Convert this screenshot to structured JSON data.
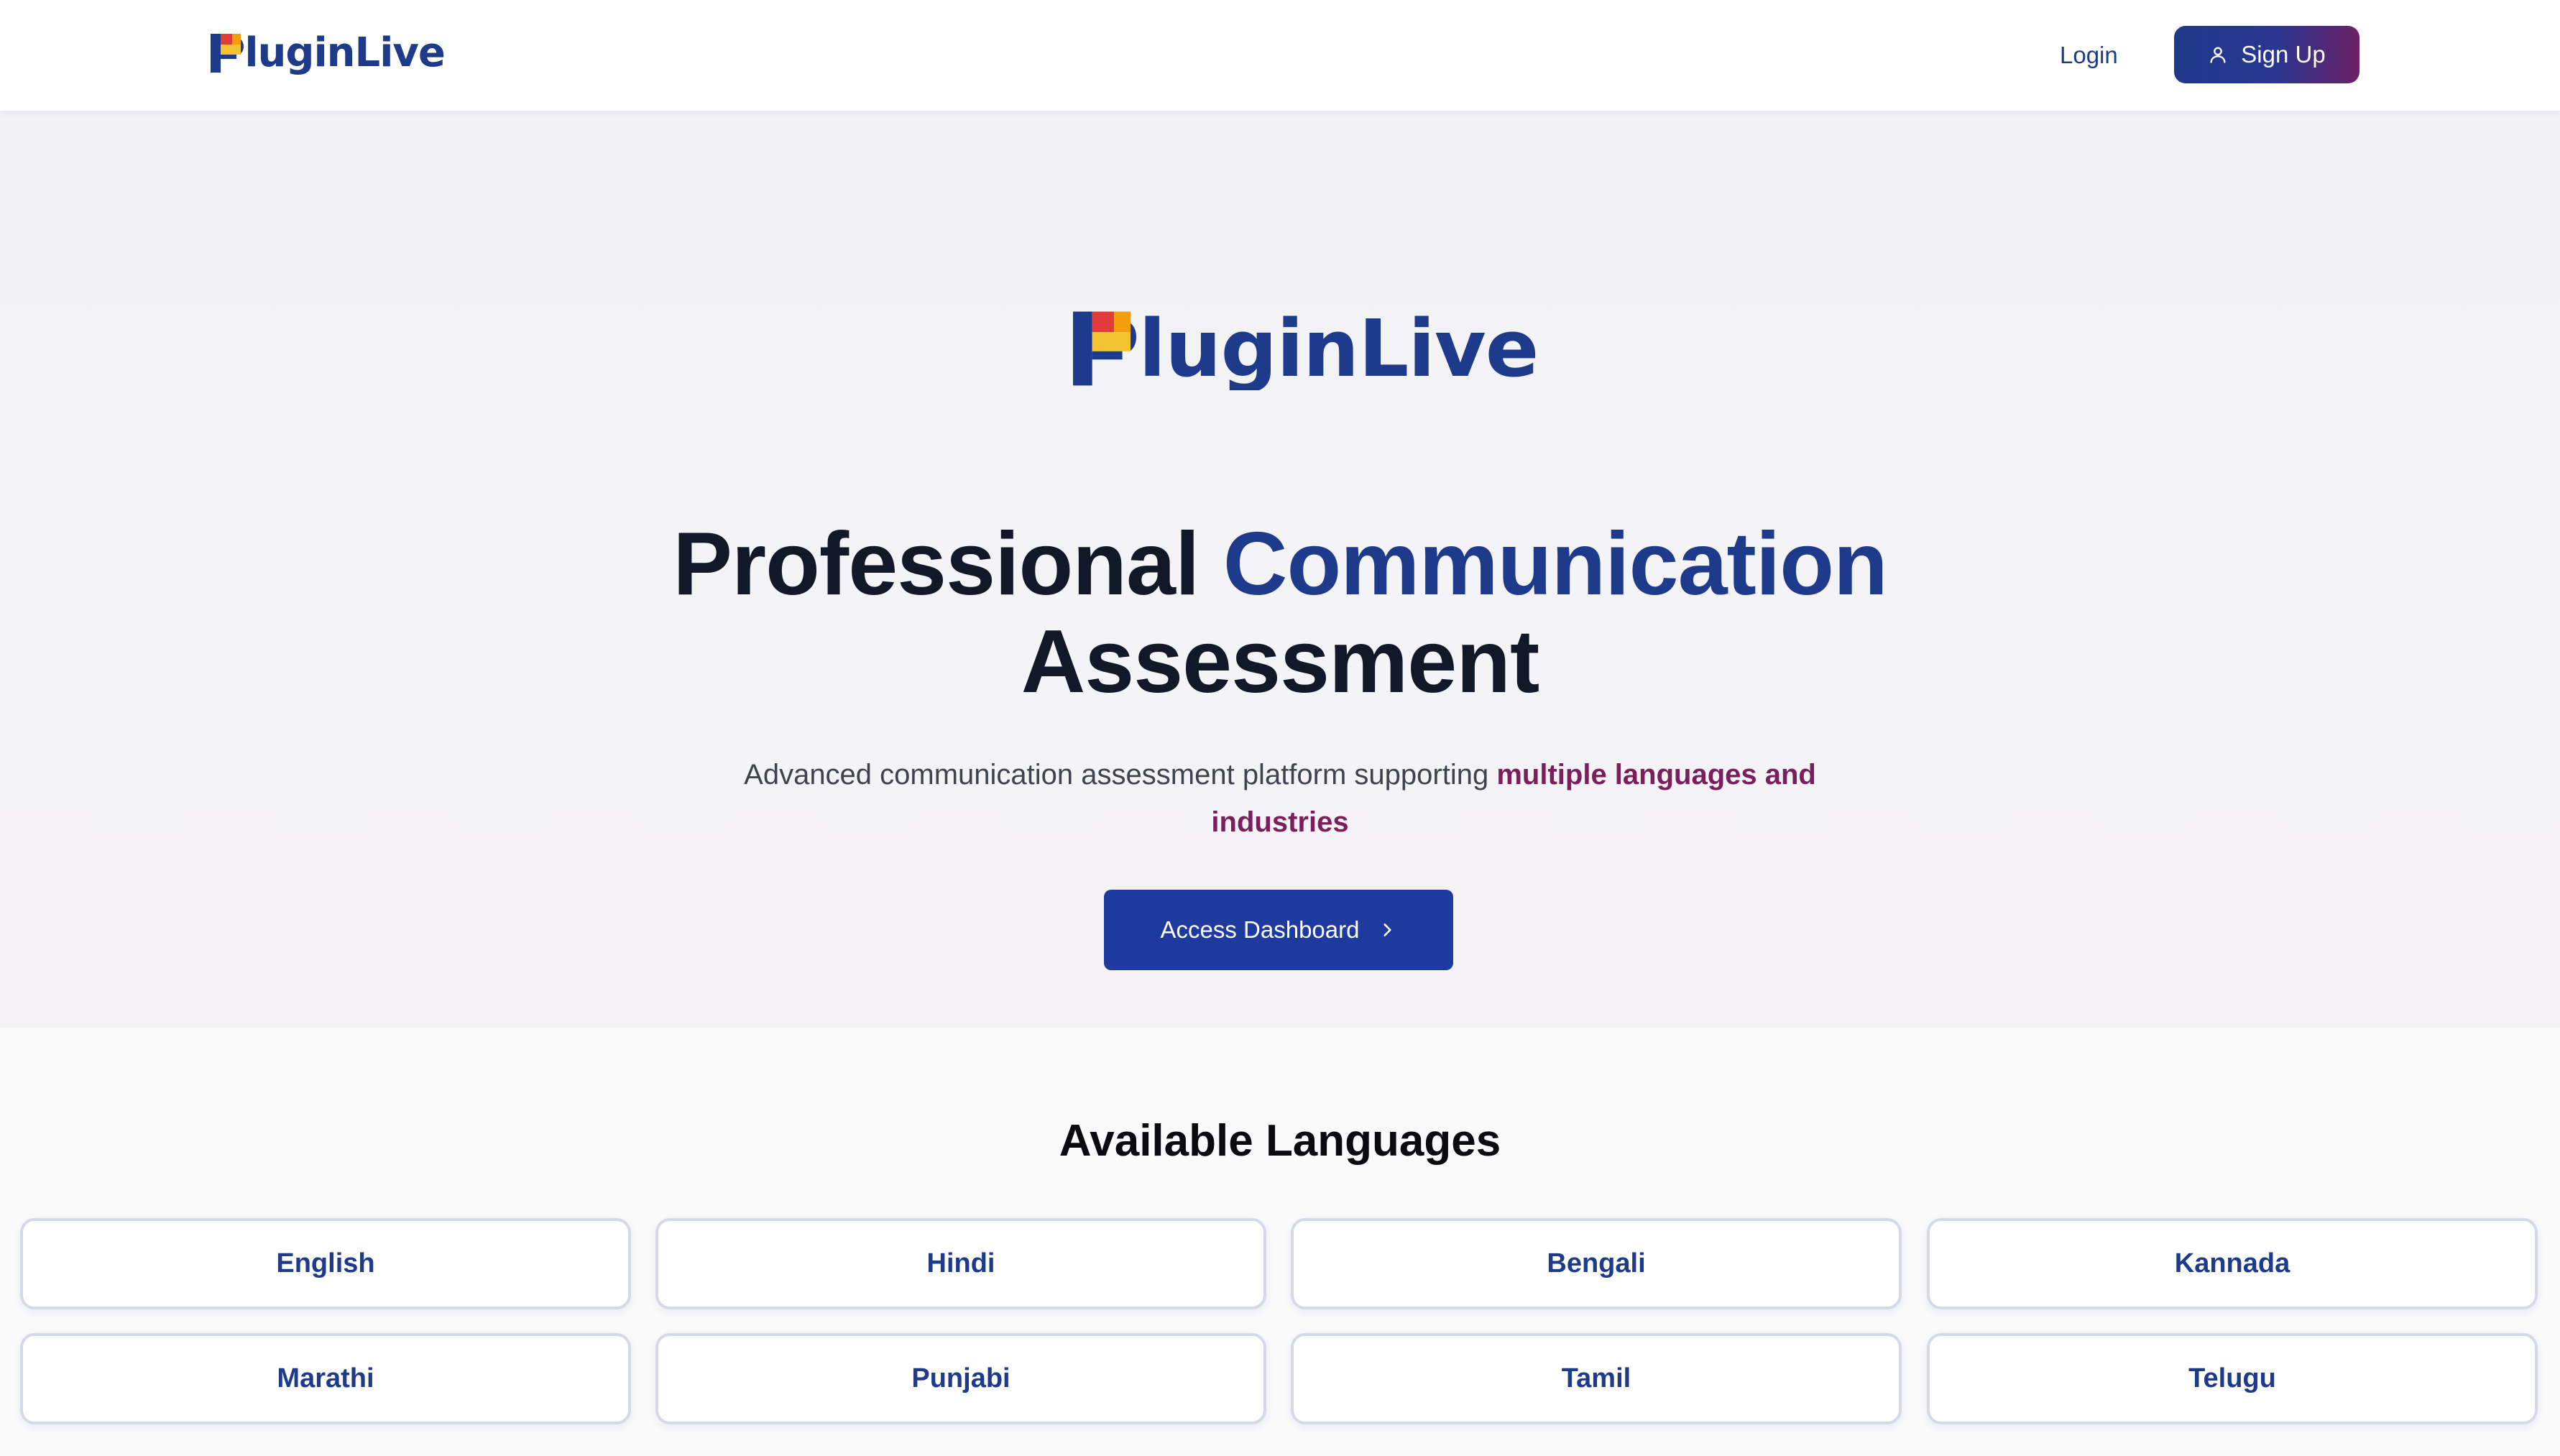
{
  "header": {
    "logo_text": "PluginLive",
    "login_label": "Login",
    "signup_label": "Sign Up"
  },
  "hero": {
    "logo_text": "PluginLive",
    "title_part1": "Professional",
    "title_accent": "Communication",
    "title_part2": "Assessment",
    "subtitle_plain": "Advanced communication assessment platform supporting",
    "subtitle_emphasis": "multiple languages and industries",
    "cta_label": "Access Dashboard"
  },
  "languages": {
    "heading": "Available Languages",
    "items": [
      "English",
      "Hindi",
      "Bengali",
      "Kannada",
      "Marathi",
      "Punjabi",
      "Tamil",
      "Telugu"
    ]
  },
  "colors": {
    "brand_blue": "#1e3a8a",
    "accent_magenta": "#7a1f5c",
    "cta_blue": "#1e3a9f"
  },
  "icons": {
    "signup": "user-icon",
    "cta": "chevron-right-icon"
  }
}
